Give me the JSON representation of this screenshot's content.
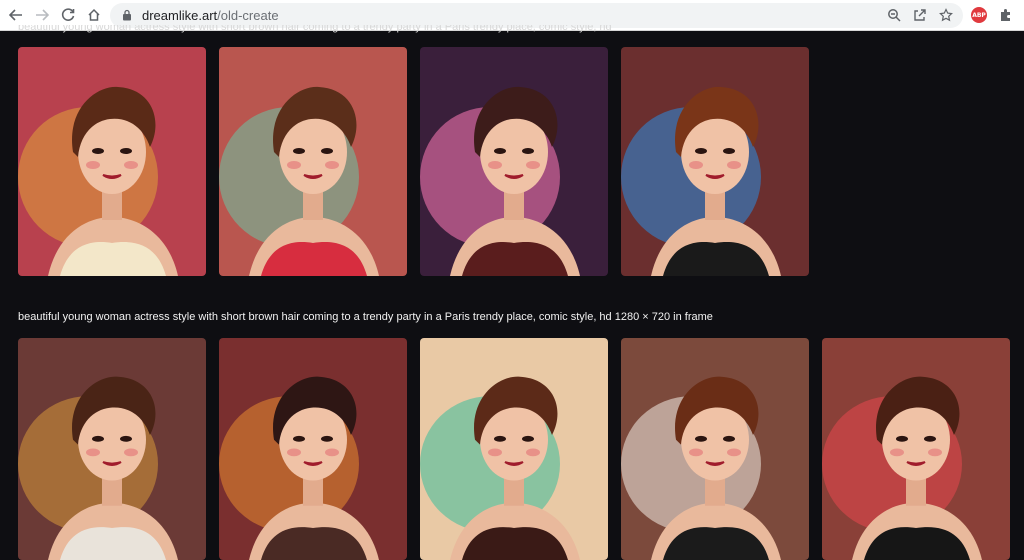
{
  "browser": {
    "url_host": "dreamlike.art",
    "url_path": "/old-create",
    "icons": [
      "back-arrow-icon",
      "forward-arrow-icon",
      "reload-icon",
      "home-icon",
      "lock-icon",
      "zoom-icon",
      "share-icon",
      "star-icon",
      "adblock-plus-icon",
      "extensions-puzzle-icon"
    ],
    "abp_label": "ABP"
  },
  "gallery": {
    "previous_caption_fragment": "beautiful young woman actress style with short brown hair coming to a trendy party in a Paris trendy place, comic style, hd",
    "caption": "beautiful young woman actress style with short brown hair coming to a trendy party in a Paris trendy place, comic style, hd 1280 × 720 in frame",
    "row1_images": [
      {
        "bg": "#b8414e",
        "accent": "#e0a23a",
        "hair": "#5a2a17",
        "top": "#f3e7c9"
      },
      {
        "bg": "#b9564f",
        "accent": "#69c7a6",
        "hair": "#5b2e1a",
        "top": "#d72d3f"
      },
      {
        "bg": "#3a1f3b",
        "accent": "#ff7ab8",
        "hair": "#3d1c1a",
        "top": "#5a1d1d"
      },
      {
        "bg": "#6b2f2f",
        "accent": "#2a8de0",
        "hair": "#7a3518",
        "top": "#1a1a1a"
      }
    ],
    "row2_images": [
      {
        "bg": "#6b3a36",
        "accent": "#d5983a",
        "hair": "#4a2416",
        "top": "#e9e3da"
      },
      {
        "bg": "#7a2f2f",
        "accent": "#e78a30",
        "hair": "#2e1614",
        "top": "#4a2a24"
      },
      {
        "bg": "#e9c9a5",
        "accent": "#3bbd9d",
        "hair": "#5c2a18",
        "top": "#3a1a16"
      },
      {
        "bg": "#7c4a3c",
        "accent": "#f3ece4",
        "hair": "#6a2d16",
        "top": "#1b1b1b"
      },
      {
        "bg": "#8a4038",
        "accent": "#e8474e",
        "hair": "#4a2014",
        "top": "#161616"
      }
    ]
  }
}
